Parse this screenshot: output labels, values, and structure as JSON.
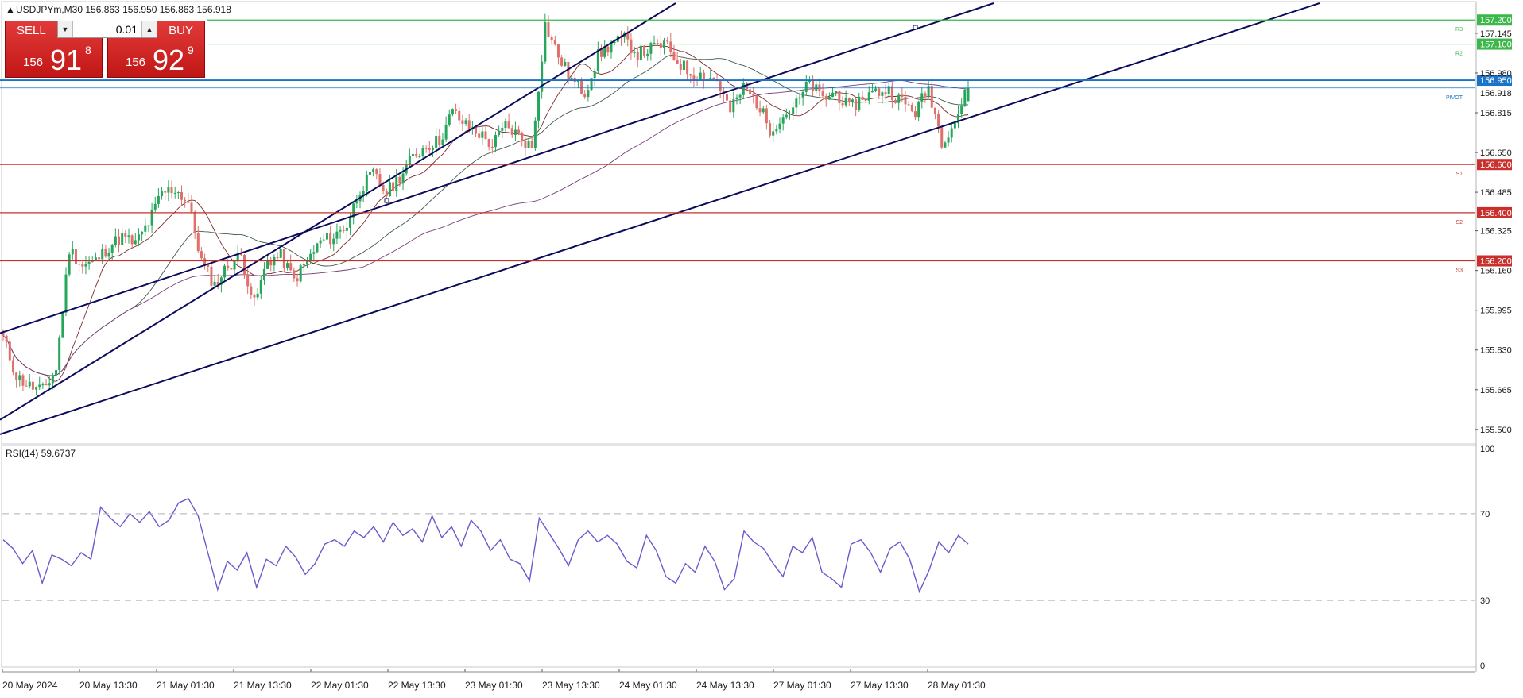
{
  "header": {
    "symbol_info": "USDJPYm,M30  156.863 156.950 156.863 156.918"
  },
  "trade_panel": {
    "sell_label": "SELL",
    "buy_label": "BUY",
    "lot_value": "0.01",
    "sell_price": {
      "small": "156",
      "big": "91",
      "sup": "8"
    },
    "buy_price": {
      "small": "156",
      "big": "92",
      "sup": "9"
    }
  },
  "colors": {
    "bull_candle": "#26a65b",
    "bear_candle": "#e0706b",
    "channel": "#0b0b5c",
    "resistance": "#3cb84a",
    "support": "#c9302c",
    "current_price": "#1a73c7",
    "rsi_line": "#6a5acd",
    "ma_fast": "#7b2a2a",
    "ma_mid": "#3d5a4a",
    "ma_slow": "#7a3f7a"
  },
  "chart_data": [
    {
      "type": "candlestick",
      "title": "USDJPYm,M30",
      "ohlc": {
        "open": 156.863,
        "high": 156.95,
        "low": 156.863,
        "close": 156.918
      },
      "ylim": [
        155.45,
        157.27
      ],
      "y_ticks": [
        "157.145",
        "156.980",
        "156.815",
        "156.650",
        "156.485",
        "156.325",
        "156.160",
        "155.995",
        "155.830",
        "155.665",
        "155.500"
      ],
      "x_ticks": [
        "20 May 2024",
        "20 May 13:30",
        "21 May 01:30",
        "21 May 13:30",
        "22 May 01:30",
        "22 May 13:30",
        "23 May 01:30",
        "23 May 13:30",
        "24 May 01:30",
        "24 May 13:30",
        "27 May 01:30",
        "27 May 13:30",
        "28 May 01:30"
      ],
      "horizontal_levels": [
        {
          "label": "R3",
          "value": 157.2,
          "tag": "157.200",
          "kind": "resistance"
        },
        {
          "label": "R2",
          "value": 157.1,
          "tag": "157.100",
          "kind": "resistance"
        },
        {
          "label": "PIVOT",
          "value": 156.918,
          "tag": "156.918",
          "kind": "pivot"
        },
        {
          "label": "",
          "value": 156.95,
          "tag": "156.950",
          "kind": "current"
        },
        {
          "label": "S1",
          "value": 156.6,
          "tag": "156.600",
          "kind": "support"
        },
        {
          "label": "S2",
          "value": 156.4,
          "tag": "156.400",
          "kind": "support"
        },
        {
          "label": "S3",
          "value": 156.2,
          "tag": "156.200",
          "kind": "support"
        }
      ],
      "close_path": [
        155.88,
        155.72,
        155.68,
        155.66,
        155.75,
        156.25,
        156.18,
        156.2,
        156.26,
        156.3,
        156.27,
        156.36,
        156.48,
        156.5,
        156.44,
        156.2,
        156.1,
        156.18,
        156.22,
        156.02,
        156.2,
        156.22,
        156.12,
        156.2,
        156.28,
        156.3,
        156.35,
        156.5,
        156.56,
        156.48,
        156.55,
        156.63,
        156.68,
        156.7,
        156.82,
        156.76,
        156.73,
        156.68,
        156.76,
        156.72,
        156.67,
        157.18,
        157.05,
        156.95,
        156.9,
        157.05,
        157.1,
        157.12,
        157.06,
        157.08,
        157.1,
        157.03,
        156.98,
        156.97,
        156.95,
        156.82,
        156.92,
        156.86,
        156.75,
        156.8,
        156.85,
        156.94,
        156.87,
        156.9,
        156.83,
        156.88,
        156.9,
        156.91,
        156.86,
        156.82,
        156.92,
        156.7,
        156.78,
        156.92
      ]
    },
    {
      "type": "line",
      "title": "RSI(14) 59.6737",
      "ylim": [
        0,
        100
      ],
      "y_ticks": [
        "100",
        "70",
        "30",
        "0"
      ],
      "levels": [
        70,
        30
      ],
      "values": [
        58,
        54,
        47,
        53,
        38,
        51,
        49,
        46,
        52,
        49,
        73,
        68,
        64,
        70,
        66,
        71,
        64,
        67,
        75,
        77,
        69,
        52,
        35,
        48,
        44,
        52,
        36,
        49,
        46,
        55,
        50,
        42,
        47,
        56,
        58,
        55,
        62,
        59,
        64,
        57,
        66,
        60,
        63,
        57,
        69,
        59,
        64,
        55,
        67,
        62,
        53,
        58,
        49,
        47,
        39,
        68,
        61,
        54,
        46,
        58,
        62,
        57,
        60,
        56,
        48,
        45,
        60,
        53,
        41,
        38,
        47,
        43,
        55,
        48,
        35,
        40,
        62,
        57,
        54,
        47,
        41,
        55,
        52,
        59,
        43,
        40,
        36,
        56,
        58,
        52,
        43,
        54,
        57,
        49,
        34,
        44,
        57,
        52,
        60,
        56
      ]
    }
  ]
}
